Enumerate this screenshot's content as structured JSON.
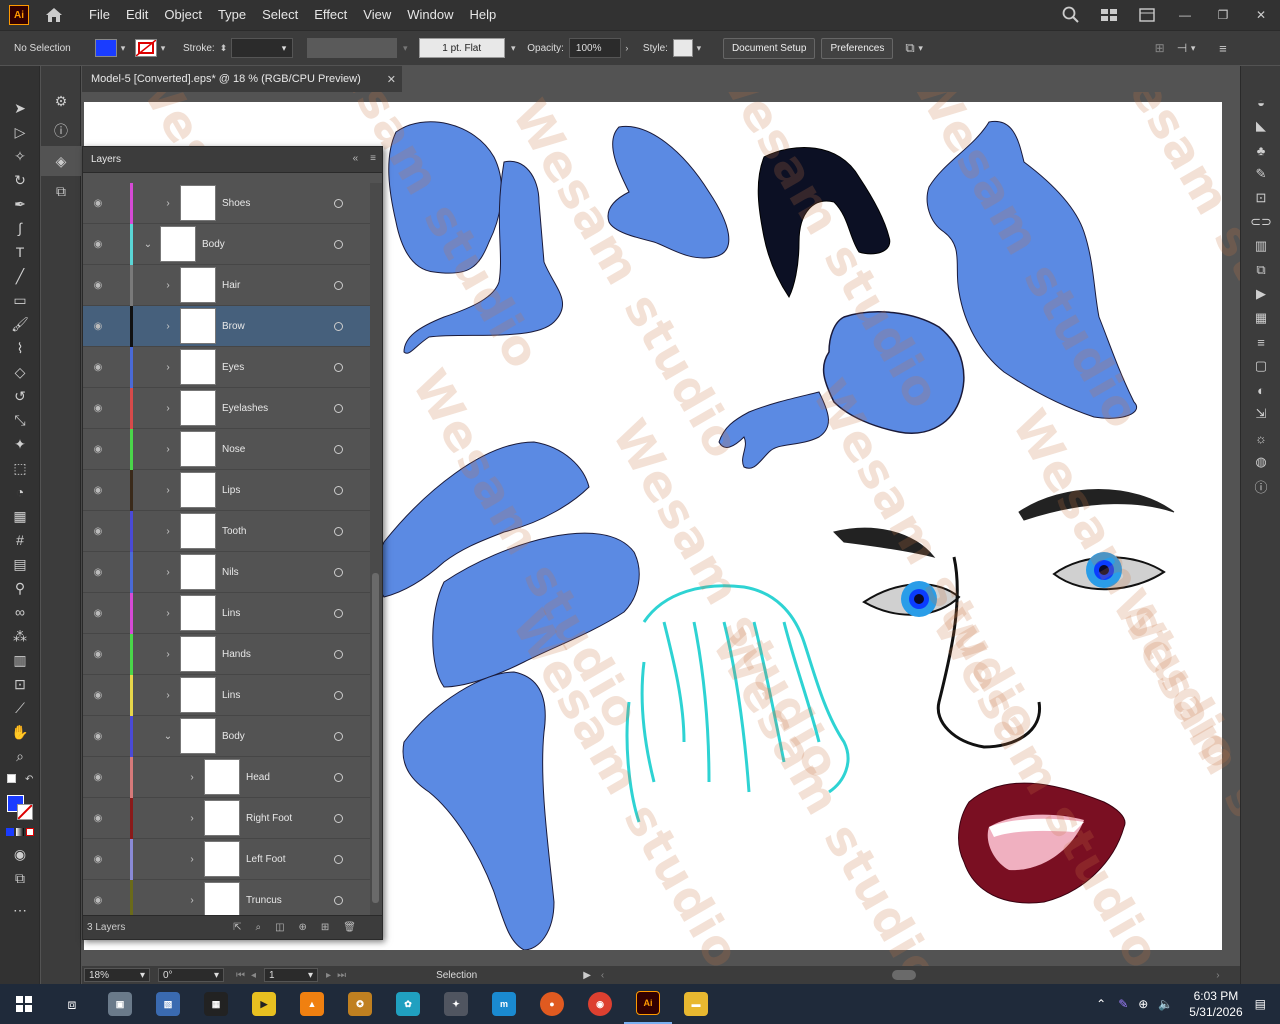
{
  "app": {
    "logo": "Ai",
    "menu": [
      "File",
      "Edit",
      "Object",
      "Type",
      "Select",
      "Effect",
      "View",
      "Window",
      "Help"
    ]
  },
  "control": {
    "selection_status": "No Selection",
    "fill_color": "#1a3cff",
    "stroke_label": "Stroke:",
    "brush_value": "1 pt. Flat",
    "opacity_label": "Opacity:",
    "opacity_value": "100%",
    "style_label": "Style:",
    "document_setup": "Document Setup",
    "preferences": "Preferences"
  },
  "document": {
    "tab_title": "Model-5 [Converted].eps* @ 18 % (RGB/CPU Preview)"
  },
  "layers": {
    "title": "Layers",
    "count": "3 Layers",
    "rows": [
      {
        "name": "Shoes",
        "color": "#d64ad6",
        "indent": 0,
        "expanded": false,
        "selected": false
      },
      {
        "name": "Body",
        "color": "#5ad6d6",
        "indent": -1,
        "expanded": true,
        "selected": false
      },
      {
        "name": "Hair",
        "color": "#7a7a7a",
        "indent": 0,
        "expanded": false,
        "selected": false
      },
      {
        "name": "Brow",
        "color": "#111111",
        "indent": 0,
        "expanded": false,
        "selected": true
      },
      {
        "name": "Eyes",
        "color": "#4a6ad6",
        "indent": 0,
        "expanded": false,
        "selected": false
      },
      {
        "name": "Eyelashes",
        "color": "#d64a4a",
        "indent": 0,
        "expanded": false,
        "selected": false
      },
      {
        "name": "Nose",
        "color": "#4ad64a",
        "indent": 0,
        "expanded": false,
        "selected": false
      },
      {
        "name": "Lips",
        "color": "#3a2a1a",
        "indent": 0,
        "expanded": false,
        "selected": false
      },
      {
        "name": "Tooth",
        "color": "#4a4ad6",
        "indent": 0,
        "expanded": false,
        "selected": false
      },
      {
        "name": "Nils",
        "color": "#4a6ad6",
        "indent": 0,
        "expanded": false,
        "selected": false
      },
      {
        "name": "Lins",
        "color": "#d64ad6",
        "indent": 0,
        "expanded": false,
        "selected": false
      },
      {
        "name": "Hands",
        "color": "#4ad64a",
        "indent": 0,
        "expanded": false,
        "selected": false
      },
      {
        "name": "Lins",
        "color": "#e6d64a",
        "indent": 0,
        "expanded": false,
        "selected": false
      },
      {
        "name": "Body",
        "color": "#4a4ad6",
        "indent": 0,
        "expanded": true,
        "selected": false
      },
      {
        "name": "Head",
        "color": "#d67a7a",
        "indent": 1,
        "expanded": false,
        "selected": false
      },
      {
        "name": "Right Foot",
        "color": "#8a1a1a",
        "indent": 1,
        "expanded": false,
        "selected": false
      },
      {
        "name": "Left Foot",
        "color": "#8a8ad6",
        "indent": 1,
        "expanded": false,
        "selected": false
      },
      {
        "name": "Truncus",
        "color": "#6a6a1a",
        "indent": 1,
        "expanded": false,
        "selected": false
      }
    ]
  },
  "status": {
    "zoom": "18%",
    "rotation": "0°",
    "artboard": "1",
    "tool": "Selection"
  },
  "taskbar": {
    "time": "6:03 PM",
    "date": "5/31/2026"
  },
  "watermark": "Wesam studio"
}
